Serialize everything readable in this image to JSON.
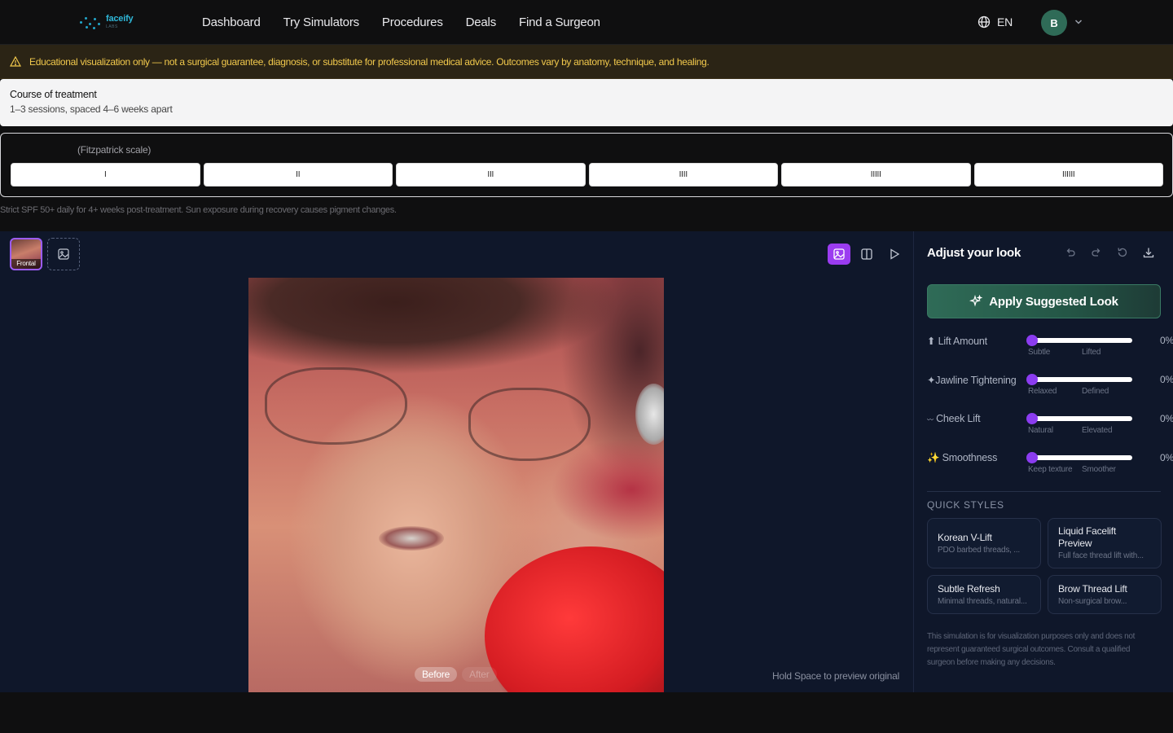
{
  "brand": {
    "name": "faceify",
    "sub": "LABS"
  },
  "nav": {
    "links": [
      "Dashboard",
      "Try Simulators",
      "Procedures",
      "Deals",
      "Find a Surgeon"
    ],
    "lang": "EN",
    "avatar_initial": "B"
  },
  "disclaimer": "Educational visualization only — not a surgical guarantee, diagnosis, or substitute for professional medical advice. Outcomes vary by anatomy, technique, and healing.",
  "course": {
    "title": "Course of treatment",
    "detail": "1–3 sessions, spaced 4–6 weeks apart"
  },
  "fitzpatrick": {
    "label": "(Fitzpatrick scale)",
    "options": [
      "I",
      "II",
      "III",
      "IIII",
      "IIIII",
      "IIIIII"
    ]
  },
  "spf_note": "Strict SPF 50+ daily for 4+ weeks post-treatment. Sun exposure during recovery causes pigment changes.",
  "workspace": {
    "thumb_label": "Frontal",
    "before_label": "Before",
    "after_label": "After",
    "hint": "Hold Space to preview original"
  },
  "panel": {
    "title": "Adjust your look",
    "apply_label": "Apply Suggested Look",
    "sliders": [
      {
        "icon": "⬆",
        "label": "Lift Amount",
        "min": "Subtle",
        "max": "Lifted",
        "value": "0%"
      },
      {
        "icon": "✦",
        "label": "Jawline Tightening",
        "min": "Relaxed",
        "max": "Defined",
        "value": "0%"
      },
      {
        "icon": "〰",
        "label": "Cheek Lift",
        "min": "Natural",
        "max": "Elevated",
        "value": "0%"
      },
      {
        "icon": "✨",
        "label": "Smoothness",
        "min": "Keep texture",
        "max": "Smoother",
        "value": "0%"
      }
    ],
    "quick_styles_title": "QUICK STYLES",
    "quick_styles": [
      {
        "name": "Korean V-Lift",
        "desc": "PDO barbed threads, ..."
      },
      {
        "name": "Liquid Facelift Preview",
        "desc": "Full face thread lift with..."
      },
      {
        "name": "Subtle Refresh",
        "desc": "Minimal threads, natural..."
      },
      {
        "name": "Brow Thread Lift",
        "desc": "Non-surgical brow..."
      }
    ],
    "note": "This simulation is for visualization purposes only and does not represent guaranteed surgical outcomes. Consult a qualified surgeon before making any decisions."
  },
  "colors": {
    "accent": "#9b3cf0",
    "brand": "#2fb7d8",
    "apply": "#2f6b57",
    "warning": "#f2c94c"
  }
}
